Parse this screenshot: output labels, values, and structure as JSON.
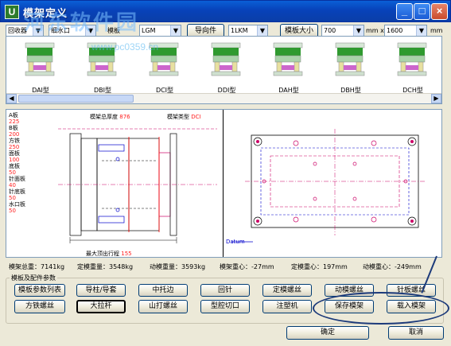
{
  "window": {
    "title": "模架定义",
    "app_icon": "U"
  },
  "watermark": {
    "text": "河东软件园",
    "url": "www.pc0359.cn"
  },
  "toolbar": {
    "combo1_value": "回收器",
    "combo2_value": "细水口",
    "label_mold": "模板",
    "combo3_value": "LGM",
    "guide_button": "导向件",
    "combo4_value": "1LKM",
    "plate_size_button": "模板大小",
    "width_value": "700",
    "unit1": "mm x",
    "height_value": "1600",
    "unit2": "mm"
  },
  "gallery": {
    "items": [
      "DAI型",
      "DBI型",
      "DCI型",
      "DDI型",
      "DAH型",
      "DBH型",
      "DCH型"
    ]
  },
  "drawing": {
    "plates": [
      {
        "name": "A板",
        "value": "225"
      },
      {
        "name": "B板",
        "value": "200"
      },
      {
        "name": "方铁",
        "value": "250"
      },
      {
        "name": "面板",
        "value": "100"
      },
      {
        "name": "底板",
        "value": "50"
      },
      {
        "name": "针面板",
        "value": "40"
      },
      {
        "name": "针底板",
        "value": "50"
      },
      {
        "name": "水口板",
        "value": "50"
      }
    ],
    "total_thickness_label": "模架总厚度",
    "total_thickness_value": "876",
    "mold_type_label": "模架类型",
    "mold_type_value": "DCI",
    "max_opening_label": "最大顶出行程",
    "max_opening_value": "155",
    "datum_label": "Datum"
  },
  "status": {
    "total_weight": "模架总重：7141kg",
    "fixed_weight": "定模重量：3548kg",
    "moving_weight": "动模重量：3593kg",
    "center_of_gravity": "模架重心：-27mm",
    "fixed_cog": "定模重心：197mm",
    "moving_cog": "动模重心：-249mm"
  },
  "group": {
    "title": "模板及配件参数",
    "row1": [
      "模板参数列表",
      "导柱/导套",
      "中托边",
      "回针",
      "定模螺丝",
      "动模螺丝",
      "针板螺丝"
    ],
    "row2": [
      "方铁螺丝",
      "大拉杆",
      "山打螺丝",
      "型腔切口",
      "注塑机",
      "保存模架",
      "载入模架"
    ]
  },
  "dialog": {
    "ok": "确定",
    "cancel": "取消"
  },
  "colors": {
    "accent_red": "#ff2020",
    "plate_magenta": "#cc0066",
    "highlight_green": "#2f9a2f"
  }
}
